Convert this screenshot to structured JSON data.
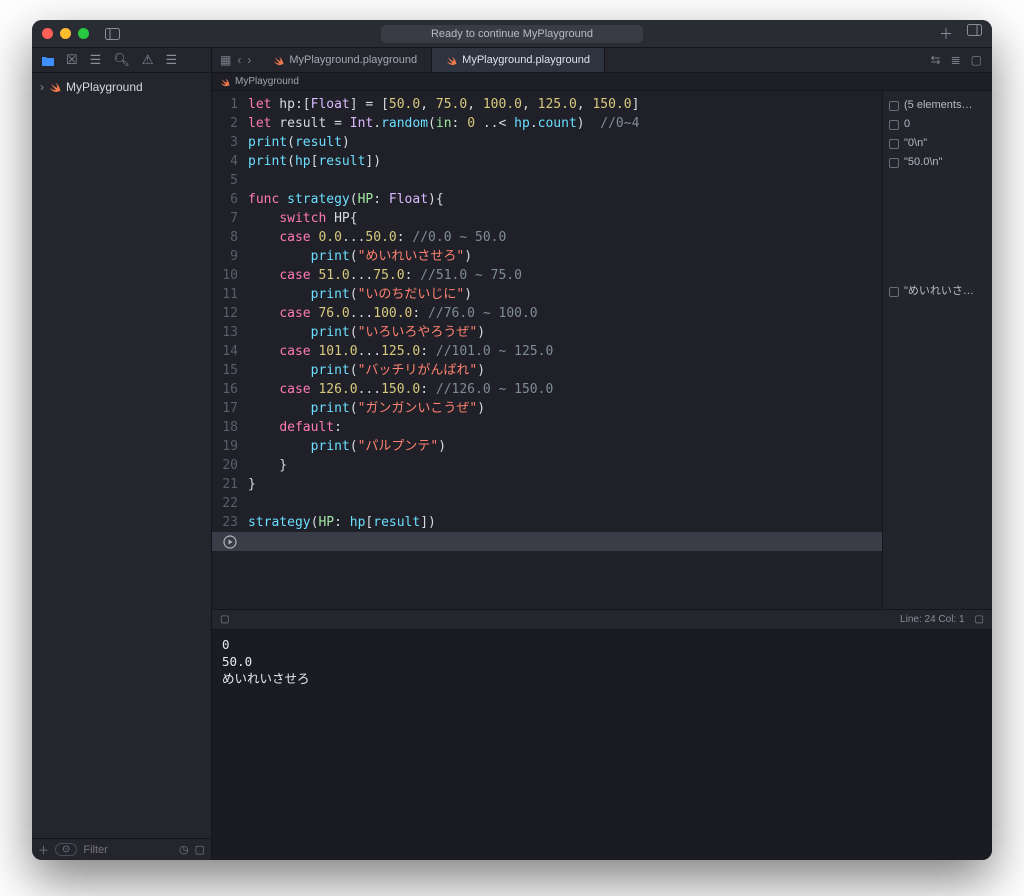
{
  "titlebar": {
    "status": "Ready to continue MyPlayground"
  },
  "navigator": {
    "item": "MyPlayground",
    "filter_placeholder": "Filter"
  },
  "tabs": {
    "tab1": "MyPlayground.playground",
    "tab2": "MyPlayground.playground"
  },
  "crumb": "MyPlayground",
  "code": {
    "l1a": "let",
    "l1b": " hp:[",
    "l1c": "Float",
    "l1d": "] = [",
    "l1e": "50.0",
    "l1f": ", ",
    "l1g": "75.0",
    "l1h": ", ",
    "l1i": "100.0",
    "l1j": ", ",
    "l1k": "125.0",
    "l1l": ", ",
    "l1m": "150.0",
    "l1n": "]",
    "l2a": "let",
    "l2b": " result = ",
    "l2c": "Int",
    "l2d": ".",
    "l2e": "random",
    "l2f": "(",
    "l2g": "in",
    "l2h": ": ",
    "l2i": "0",
    "l2j": " ..< ",
    "l2k": "hp",
    "l2l": ".",
    "l2m": "count",
    "l2n": ")  ",
    "l2o": "//0~4",
    "l3a": "print",
    "l3b": "(",
    "l3c": "result",
    "l3d": ")",
    "l4a": "print",
    "l4b": "(",
    "l4c": "hp",
    "l4d": "[",
    "l4e": "result",
    "l4f": "])",
    "l5": "",
    "l6a": "func",
    "l6b": " ",
    "l6c": "strategy",
    "l6d": "(",
    "l6e": "HP",
    "l6f": ": ",
    "l6g": "Float",
    "l6h": "){",
    "l7a": "    ",
    "l7b": "switch",
    "l7c": " HP{",
    "l8a": "    ",
    "l8b": "case",
    "l8c": " ",
    "l8d": "0.0",
    "l8e": "...",
    "l8f": "50.0",
    "l8g": ": ",
    "l8h": "//0.0 ~ 50.0",
    "l9a": "        ",
    "l9b": "print",
    "l9c": "(",
    "l9d": "\"めいれいさせろ\"",
    "l9e": ")",
    "l10a": "    ",
    "l10b": "case",
    "l10c": " ",
    "l10d": "51.0",
    "l10e": "...",
    "l10f": "75.0",
    "l10g": ": ",
    "l10h": "//51.0 ~ 75.0",
    "l11a": "        ",
    "l11b": "print",
    "l11c": "(",
    "l11d": "\"いのちだいじに\"",
    "l11e": ")",
    "l12a": "    ",
    "l12b": "case",
    "l12c": " ",
    "l12d": "76.0",
    "l12e": "...",
    "l12f": "100.0",
    "l12g": ": ",
    "l12h": "//76.0 ~ 100.0",
    "l13a": "        ",
    "l13b": "print",
    "l13c": "(",
    "l13d": "\"いろいろやろうぜ\"",
    "l13e": ")",
    "l14a": "    ",
    "l14b": "case",
    "l14c": " ",
    "l14d": "101.0",
    "l14e": "...",
    "l14f": "125.0",
    "l14g": ": ",
    "l14h": "//101.0 ~ 125.0",
    "l15a": "        ",
    "l15b": "print",
    "l15c": "(",
    "l15d": "\"バッチリがんばれ\"",
    "l15e": ")",
    "l16a": "    ",
    "l16b": "case",
    "l16c": " ",
    "l16d": "126.0",
    "l16e": "...",
    "l16f": "150.0",
    "l16g": ": ",
    "l16h": "//126.0 ~ 150.0",
    "l17a": "        ",
    "l17b": "print",
    "l17c": "(",
    "l17d": "\"ガンガンいこうぜ\"",
    "l17e": ")",
    "l18a": "    ",
    "l18b": "default",
    "l18c": ":",
    "l19a": "        ",
    "l19b": "print",
    "l19c": "(",
    "l19d": "\"パルプンテ\"",
    "l19e": ")",
    "l20": "    }",
    "l21": "}",
    "l22": "",
    "l23a": "strategy",
    "l23b": "(",
    "l23c": "HP",
    "l23d": ": ",
    "l23e": "hp",
    "l23f": "[",
    "l23g": "result",
    "l23h": "])"
  },
  "gutter": {
    "1": "1",
    "2": "2",
    "3": "3",
    "4": "4",
    "5": "5",
    "6": "6",
    "7": "7",
    "8": "8",
    "9": "9",
    "10": "10",
    "11": "11",
    "12": "12",
    "13": "13",
    "14": "14",
    "15": "15",
    "16": "16",
    "17": "17",
    "18": "18",
    "19": "19",
    "20": "20",
    "21": "21",
    "22": "22",
    "23": "23"
  },
  "results": {
    "r1": "(5 elements…",
    "r2": "0",
    "r3": "\"0\\n\"",
    "r4": "\"50.0\\n\"",
    "r5": "\"めいれいさ…"
  },
  "console": {
    "status": "Line: 24  Col: 1",
    "out": "0\n50.0\nめいれいさせろ"
  }
}
